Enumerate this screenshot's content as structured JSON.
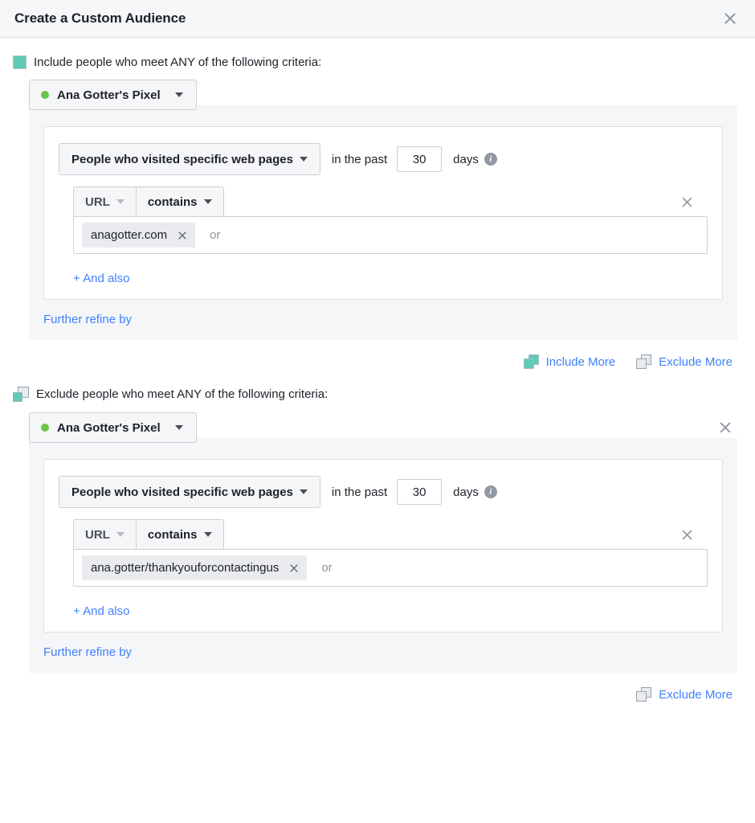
{
  "dialog": {
    "title": "Create a Custom Audience",
    "close_icon": "close-icon"
  },
  "sections": [
    {
      "kind": "include",
      "glyph": "include-square-icon",
      "heading": "Include people who meet ANY of the following criteria:",
      "pixel": {
        "status_dot": "green-status-dot",
        "name": "Ana Gotter's Pixel",
        "caret": "chevron-down-icon"
      },
      "has_section_remove": false,
      "rule": {
        "event_label": "People who visited specific web pages",
        "event_caret": "chevron-down-icon",
        "in_the_past": "in the past",
        "days_value": "30",
        "days_label": "days",
        "info_icon": "info-icon",
        "field_label": "URL",
        "field_caret": "chevron-down-icon",
        "operator_label": "contains",
        "operator_caret": "chevron-down-icon",
        "remove_icon": "close-icon",
        "token_value": "anagotter.com",
        "token_remove_icon": "close-icon",
        "or_placeholder": "or",
        "and_also": "+ And also"
      },
      "further_refine": "Further refine by"
    },
    {
      "kind": "exclude",
      "glyph": "exclude-square-icon",
      "heading": "Exclude people who meet ANY of the following criteria:",
      "pixel": {
        "status_dot": "green-status-dot",
        "name": "Ana Gotter's Pixel",
        "caret": "chevron-down-icon"
      },
      "has_section_remove": true,
      "rule": {
        "event_label": "People who visited specific web pages",
        "event_caret": "chevron-down-icon",
        "in_the_past": "in the past",
        "days_value": "30",
        "days_label": "days",
        "info_icon": "info-icon",
        "field_label": "URL",
        "field_caret": "chevron-down-icon",
        "operator_label": "contains",
        "operator_caret": "chevron-down-icon",
        "remove_icon": "close-icon",
        "token_value": "ana.gotter/thankyouforcontactingus",
        "token_remove_icon": "close-icon",
        "or_placeholder": "or",
        "and_also": "+ And also"
      },
      "further_refine": "Further refine by"
    }
  ],
  "middle_actions": {
    "include_more": "Include More",
    "include_more_icon": "include-more-icon",
    "exclude_more": "Exclude More",
    "exclude_more_icon": "exclude-more-icon"
  },
  "bottom_actions": {
    "exclude_more": "Exclude More",
    "exclude_more_icon": "exclude-more-icon"
  },
  "colors": {
    "accent_link": "#4080ff",
    "include_teal": "#5ecbb4",
    "status_green": "#6dc24b",
    "panel_gray": "#f5f6f7",
    "border_gray": "#ccd0d5",
    "text_primary": "#1d2129",
    "text_muted": "#8d949e"
  }
}
